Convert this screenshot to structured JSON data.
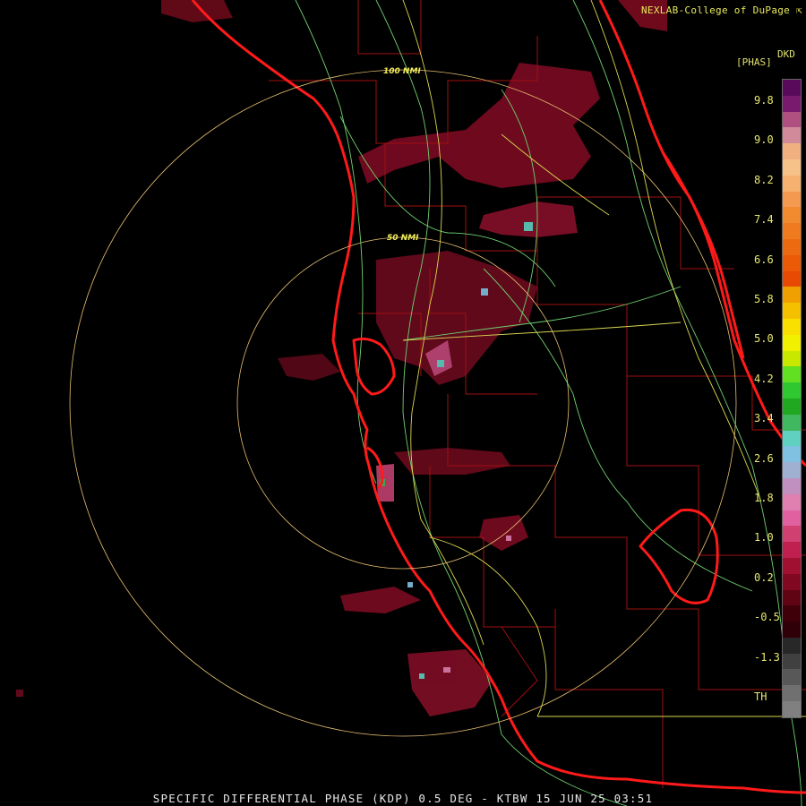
{
  "credit": "NEXLAB-College of DuPage",
  "credit_icon": "cursor-arrow-icon",
  "product": "SPECIFIC DIFFERENTIAL PHASE (KDP) 0.5 DEG - KTBW 15 JUN 25 03:51",
  "units": {
    "top": "DKD",
    "bracket": "[PHAS]"
  },
  "range_rings": [
    "50 NMI",
    "100 NMI"
  ],
  "legend": {
    "ticks": [
      "9.8",
      "9.0",
      "8.2",
      "7.4",
      "6.6",
      "5.8",
      "5.0",
      "4.2",
      "3.4",
      "2.6",
      "1.8",
      "1.0",
      "0.2",
      "-0.5",
      "-1.3",
      "TH"
    ],
    "colors": [
      "#5a0a5a",
      "#7a1a6e",
      "#b05080",
      "#d08a9a",
      "#f0b080",
      "#f7c28a",
      "#f6b070",
      "#f49a50",
      "#f28a30",
      "#f07a20",
      "#ee6a10",
      "#ec5a08",
      "#e84a04",
      "#f0a000",
      "#f5c000",
      "#fae000",
      "#f0f000",
      "#c8e800",
      "#60e020",
      "#30c830",
      "#20a820",
      "#40b860",
      "#60d0c0",
      "#80c0e0",
      "#a0b0d0",
      "#c090c0",
      "#e080b0",
      "#e060a0",
      "#d04070",
      "#c02050",
      "#a01030",
      "#800820",
      "#600414",
      "#40000a",
      "#300008",
      "#282828",
      "#404040",
      "#585858",
      "#707070",
      "#808080"
    ],
    "accent": "#e8e870"
  },
  "map": {
    "coast_color": "#ff1a1a",
    "county_color": "#a01010",
    "road_color": "#d8d850",
    "highway_color": "#70d070",
    "ring_color": "#e8c070"
  }
}
